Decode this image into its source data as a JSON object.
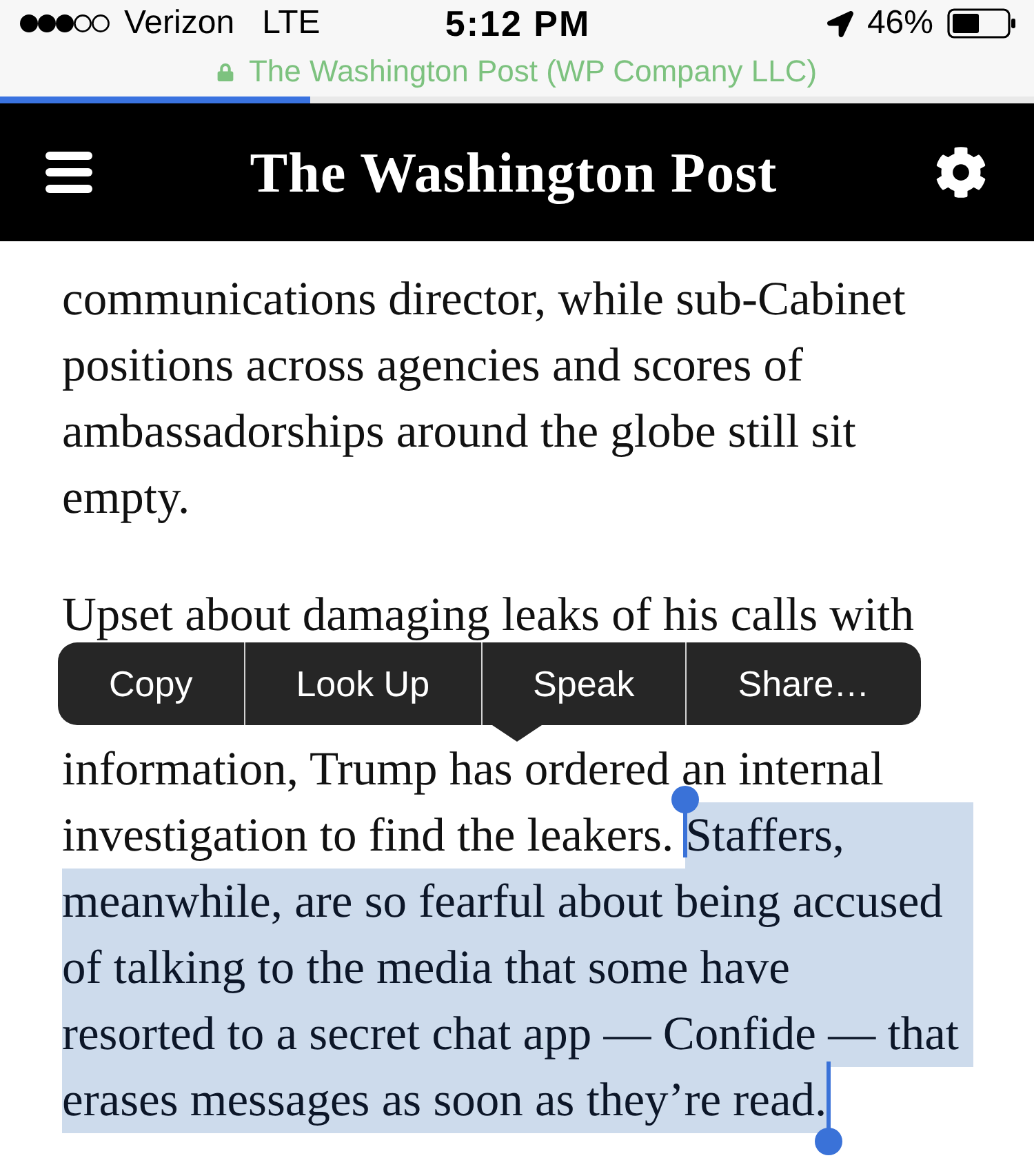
{
  "status_bar": {
    "carrier": "Verizon",
    "network": "LTE",
    "time": "5:12 PM",
    "battery": "46%"
  },
  "address_bar": {
    "secure": true,
    "site": "The Washington Post (WP Company LLC)"
  },
  "load_progress": {
    "level": 0.3
  },
  "header": {
    "logo": "The Washington Post"
  },
  "article": {
    "paragraphs": [
      {
        "lines": [
          {
            "kind": "text",
            "runs": [
              {
                "text": "communications director, while sub-Cabinet",
                "selected": false
              }
            ]
          },
          {
            "kind": "text",
            "runs": [
              {
                "text": "positions across agencies and scores of",
                "selected": false
              }
            ]
          },
          {
            "kind": "text",
            "runs": [
              {
                "text": "ambassadorships around the globe still sit",
                "selected": false
              }
            ]
          },
          {
            "kind": "text",
            "runs": [
              {
                "text": "empty.",
                "selected": false
              }
            ]
          }
        ]
      },
      {
        "lines": [
          {
            "kind": "text",
            "runs": [
              {
                "text": "Upset about damaging leaks of his calls with",
                "selected": false
              }
            ]
          },
          {
            "kind": "menu",
            "items": [
              {
                "label": "Copy"
              },
              {
                "label": "Look Up"
              },
              {
                "label": "Speak"
              },
              {
                "label": "Share…"
              }
            ]
          },
          {
            "kind": "text",
            "runs": [
              {
                "text": "information, Trump has ordered an internal",
                "selected": false
              }
            ]
          },
          {
            "kind": "text",
            "runs": [
              {
                "text": "investigation to find the leakers. ",
                "selected": false
              },
              {
                "text": "Staffers,",
                "selected": true
              }
            ]
          },
          {
            "kind": "text",
            "runs": [
              {
                "text": "meanwhile, are so fearful about being accused",
                "selected": true
              }
            ]
          },
          {
            "kind": "text",
            "runs": [
              {
                "text": "of talking to the media that some have",
                "selected": true
              }
            ]
          },
          {
            "kind": "text",
            "runs": [
              {
                "text": "resorted to a secret chat app — Confide — that",
                "selected": true
              }
            ]
          },
          {
            "kind": "text",
            "runs": [
              {
                "text": "erases messages as soon as they’re read.",
                "selected": true
              }
            ]
          }
        ]
      }
    ]
  }
}
